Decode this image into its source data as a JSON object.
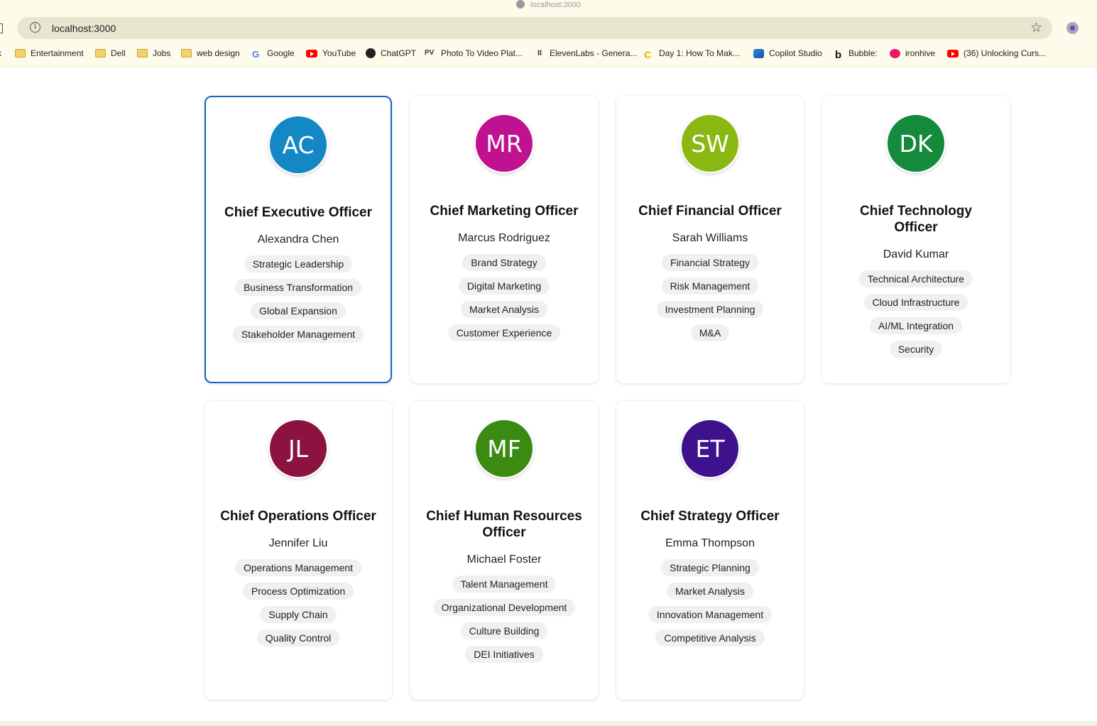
{
  "browser": {
    "tab_title": "localhost:3000",
    "url": "localhost:3000",
    "bookmarks": [
      {
        "label": "Entertainment",
        "icon": "folder-icon"
      },
      {
        "label": "Dell",
        "icon": "folder-icon"
      },
      {
        "label": "Jobs",
        "icon": "folder-icon"
      },
      {
        "label": "web design",
        "icon": "folder-icon"
      },
      {
        "label": "Google",
        "icon": "google-icon"
      },
      {
        "label": "YouTube",
        "icon": "youtube-icon"
      },
      {
        "label": "ChatGPT",
        "icon": "chatgpt-icon"
      },
      {
        "label": "Photo To Video Plat...",
        "icon": "photo-video-icon"
      },
      {
        "label": "ElevenLabs - Genera...",
        "icon": "elevenlabs-icon"
      },
      {
        "label": "Day 1: How To Mak...",
        "icon": "day-icon"
      },
      {
        "label": "Copilot Studio",
        "icon": "copilot-icon"
      },
      {
        "label": "Bubble:",
        "icon": "bubble-icon"
      },
      {
        "label": "ironhive",
        "icon": "ironhive-icon"
      },
      {
        "label": "(36) Unlocking Curs...",
        "icon": "youtube-icon"
      }
    ]
  },
  "executives": [
    {
      "initials": "AC",
      "color": "#1488c4",
      "role": "Chief Executive Officer",
      "name": "Alexandra Chen",
      "skills": [
        "Strategic Leadership",
        "Business Transformation",
        "Global Expansion",
        "Stakeholder Management"
      ]
    },
    {
      "initials": "MR",
      "color": "#bf1190",
      "role": "Chief Marketing Officer",
      "name": "Marcus Rodriguez",
      "skills": [
        "Brand Strategy",
        "Digital Marketing",
        "Market Analysis",
        "Customer Experience"
      ]
    },
    {
      "initials": "SW",
      "color": "#8ab812",
      "role": "Chief Financial Officer",
      "name": "Sarah Williams",
      "skills": [
        "Financial Strategy",
        "Risk Management",
        "Investment Planning",
        "M&A"
      ]
    },
    {
      "initials": "DK",
      "color": "#138a3c",
      "role": "Chief Technology Officer",
      "name": "David Kumar",
      "skills": [
        "Technical Architecture",
        "Cloud Infrastructure",
        "AI/ML Integration",
        "Security"
      ]
    },
    {
      "initials": "JL",
      "color": "#8c1240",
      "role": "Chief Operations Officer",
      "name": "Jennifer Liu",
      "skills": [
        "Operations Management",
        "Process Optimization",
        "Supply Chain",
        "Quality Control"
      ]
    },
    {
      "initials": "MF",
      "color": "#3b8a12",
      "role": "Chief Human Resources Officer",
      "name": "Michael Foster",
      "skills": [
        "Talent Management",
        "Organizational Development",
        "Culture Building",
        "DEI Initiatives"
      ]
    },
    {
      "initials": "ET",
      "color": "#3e128c",
      "role": "Chief Strategy Officer",
      "name": "Emma Thompson",
      "skills": [
        "Strategic Planning",
        "Market Analysis",
        "Innovation Management",
        "Competitive Analysis"
      ]
    }
  ]
}
